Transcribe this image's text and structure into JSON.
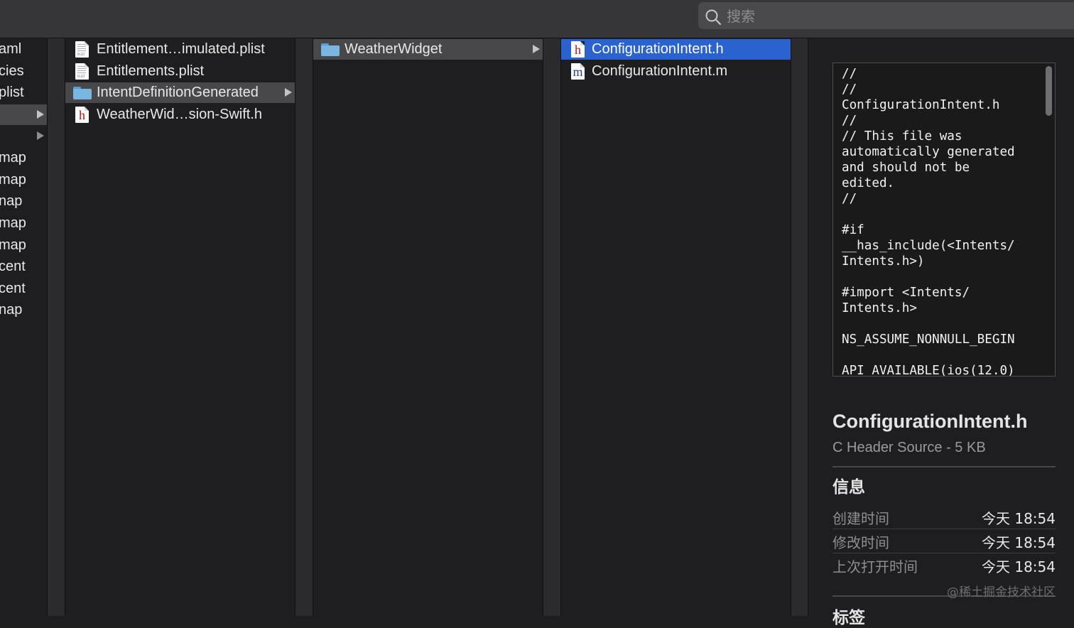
{
  "search": {
    "placeholder": "搜索"
  },
  "column1": {
    "rows": [
      {
        "label": "aml"
      },
      {
        "label": "cies"
      },
      {
        "label": "plist"
      },
      {
        "label": ""
      },
      {
        "label": ""
      },
      {
        "label": "map"
      },
      {
        "label": "map"
      },
      {
        "label": "nap"
      },
      {
        "label": "map"
      },
      {
        "label": "map"
      },
      {
        "label": "cent"
      },
      {
        "label": "cent"
      },
      {
        "label": "nap"
      }
    ]
  },
  "column2": {
    "rows": [
      {
        "label": "Entitlement…imulated.plist",
        "icon": "plist-file-icon"
      },
      {
        "label": "Entitlements.plist",
        "icon": "plist-file-icon"
      },
      {
        "label": "IntentDefinitionGenerated",
        "icon": "folder-icon"
      },
      {
        "label": "WeatherWid…sion-Swift.h",
        "icon": "header-file-icon",
        "glyph": "h"
      }
    ]
  },
  "column3": {
    "rows": [
      {
        "label": "WeatherWidget",
        "icon": "folder-icon"
      }
    ]
  },
  "column4": {
    "rows": [
      {
        "label": "ConfigurationIntent.h",
        "icon": "header-file-icon",
        "glyph": "h"
      },
      {
        "label": "ConfigurationIntent.m",
        "icon": "objc-source-file-icon",
        "glyph": "m"
      }
    ]
  },
  "preview": {
    "code": "//\n//\nConfigurationIntent.h\n//\n// This file was\nautomatically generated\nand should not be\nedited.\n//\n\n#if\n__has_include(<Intents/\nIntents.h>)\n\n#import <Intents/\nIntents.h>\n\nNS_ASSUME_NONNULL_BEGIN\n\nAPI_AVAILABLE(ios(12.0)",
    "file_name": "ConfigurationIntent.h",
    "file_kind": "C Header Source - 5 KB",
    "info_title": "信息",
    "info": [
      {
        "key": "创建时间",
        "value": "今天 18:54"
      },
      {
        "key": "修改时间",
        "value": "今天 18:54"
      },
      {
        "key": "上次打开时间",
        "value": "今天 18:54"
      }
    ],
    "tags_title": "标签"
  },
  "watermark": "@稀土掘金技术社区",
  "colors": {
    "selection": "#2a62cf",
    "selection_inactive": "#48484a",
    "background": "#1e1e20"
  }
}
